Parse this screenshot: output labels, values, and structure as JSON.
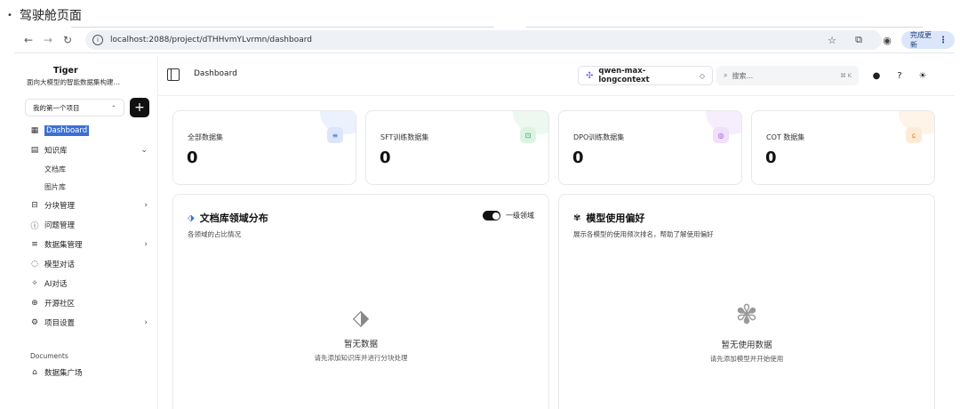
{
  "doc": {
    "bullet": "•",
    "title": "驾驶舱页面"
  },
  "browser": {
    "url": "localhost:2088/project/dTHHvmYLvrmn/dashboard",
    "update_label": "完成更新"
  },
  "sidebar": {
    "brand_name": "Tiger",
    "brand_sub": "面向大模型的智能数据集构建…",
    "project_select": "我的第一个项目",
    "add_label": "+",
    "items": [
      {
        "label": "Dashboard",
        "icon": "grid-icon"
      },
      {
        "label": "知识库",
        "icon": "book-icon"
      },
      {
        "label": "文档库"
      },
      {
        "label": "图片库"
      },
      {
        "label": "分块管理",
        "icon": "chunk-icon"
      },
      {
        "label": "问题管理",
        "icon": "question-icon"
      },
      {
        "label": "数据集管理",
        "icon": "database-icon"
      },
      {
        "label": "模型对话",
        "icon": "chat-icon"
      },
      {
        "label": "AI对话",
        "icon": "sparkle-icon"
      },
      {
        "label": "开源社区",
        "icon": "globe-icon"
      },
      {
        "label": "项目设置",
        "icon": "settings-icon"
      }
    ],
    "section_documents": "Documents",
    "dataset_square": "数据集广场"
  },
  "topbar": {
    "breadcrumb": "Dashboard",
    "model": "qwen-max-longcontext",
    "search_placeholder": "搜索...",
    "search_kbd": "⌘ K"
  },
  "stats": [
    {
      "label": "全部数据集",
      "value": "0",
      "color": "#3b6fd4",
      "bg": "#dbe6fb"
    },
    {
      "label": "SFT训练数据集",
      "value": "0",
      "color": "#2e9d5b",
      "bg": "#dcf3e4"
    },
    {
      "label": "DPO训练数据集",
      "value": "0",
      "color": "#9a46d8",
      "bg": "#efe0fb"
    },
    {
      "label": "COT 数据集",
      "value": "0",
      "color": "#e2882a",
      "bg": "#fdebd6"
    }
  ],
  "domain_panel": {
    "title": "文档库领域分布",
    "subtitle": "各领域的占比情况",
    "toggle_label": "一级领域",
    "empty_title": "暂无数据",
    "empty_sub": "请先添加知识库并进行分块处理"
  },
  "model_panel": {
    "title": "模型使用偏好",
    "subtitle": "展示各模型的使用频次排名，帮助了解使用偏好",
    "empty_title": "暂无使用数据",
    "empty_sub": "请先添加模型并开始使用"
  }
}
